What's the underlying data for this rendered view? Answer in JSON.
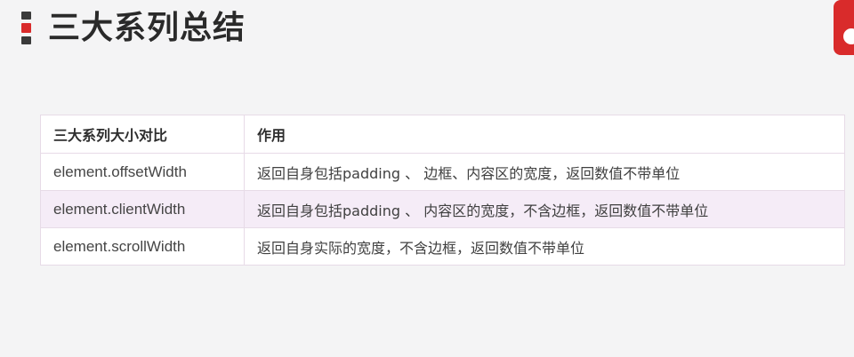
{
  "title": "三大系列总结",
  "icons": {
    "title_marks": "bullet-marks-icon",
    "logo": "brand-logo-icon"
  },
  "colors": {
    "accent": "#d92b2b",
    "even_row": "#f5ecf7",
    "border": "#e7dbe7"
  },
  "table": {
    "headers": [
      "三大系列大小对比",
      "作用"
    ],
    "rows": [
      {
        "property": "element.offsetWidth",
        "description": "返回自身包括padding 、 边框、内容区的宽度，返回数值不带单位"
      },
      {
        "property": "element.clientWidth",
        "description": "返回自身包括padding 、 内容区的宽度，不含边框，返回数值不带单位"
      },
      {
        "property": "element.scrollWidth",
        "description": "返回自身实际的宽度，不含边框，返回数值不带单位"
      }
    ]
  }
}
